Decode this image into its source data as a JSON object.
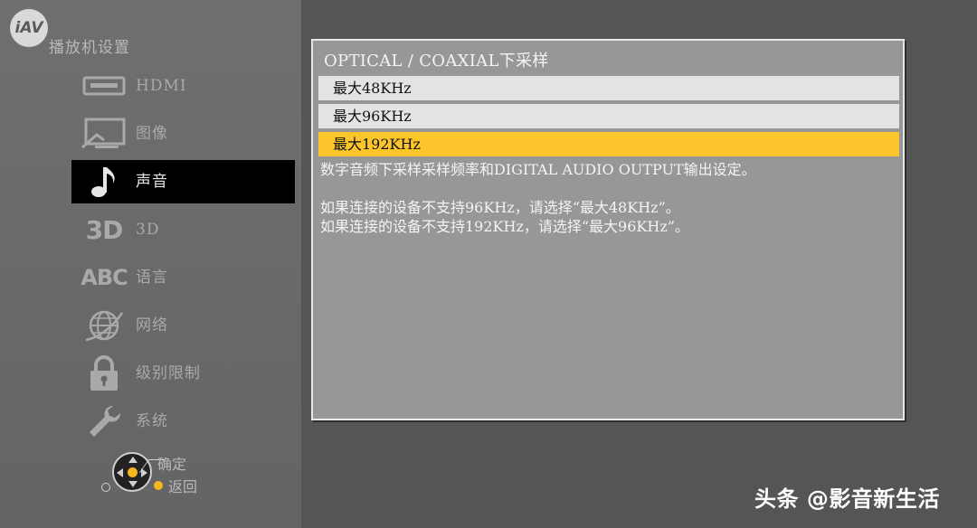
{
  "logo": {
    "text": "iAV"
  },
  "sidebar": {
    "title": "播放机设置",
    "items": [
      {
        "label": "HDMI",
        "icon": "hdmi-port-icon"
      },
      {
        "label": "图像",
        "icon": "picture-icon"
      },
      {
        "label": "声音",
        "icon": "music-note-icon",
        "active": true
      },
      {
        "label": "3D",
        "icon": "3d-icon",
        "icon_text": "3D"
      },
      {
        "label": "语言",
        "icon": "language-icon",
        "icon_text": "ABC"
      },
      {
        "label": "网络",
        "icon": "globe-icon"
      },
      {
        "label": "级别限制",
        "icon": "lock-icon"
      },
      {
        "label": "系统",
        "icon": "wrench-icon"
      }
    ]
  },
  "nav_hint": {
    "ok_label": "确定",
    "back_label": "返回"
  },
  "panel": {
    "title": "OPTICAL / COAXIAL下采样",
    "options": [
      {
        "label": "最大48KHz",
        "selected": false
      },
      {
        "label": "最大96KHz",
        "selected": false
      },
      {
        "label": "最大192KHz",
        "selected": true
      }
    ],
    "description": [
      "数字音频下采样采样频率和DIGITAL AUDIO OUTPUT输出设定。",
      "",
      "如果连接的设备不支持96KHz，请选择“最大48KHz”。",
      "如果连接的设备不支持192KHz，请选择“最大96KHz”。"
    ]
  },
  "watermark": "头条 @影音新生活",
  "colors": {
    "highlight": "#fcc52c",
    "active_menu_bg": "#000000",
    "panel_bg": "#979797"
  }
}
